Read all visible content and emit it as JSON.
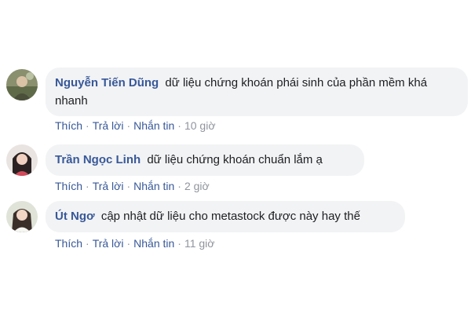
{
  "comments": [
    {
      "author": "Nguyễn Tiến Dũng",
      "text": "dữ liệu chứng khoán phái sinh của phần mềm khá nhanh",
      "actions": {
        "like": "Thích",
        "reply": "Trả lời",
        "message": "Nhắn tin",
        "time": "10 giờ"
      },
      "avatar_icon": "avatar-photo-icon"
    },
    {
      "author": "Trần Ngọc Linh",
      "text": "dữ liệu chứng khoán chuẩn lắm ạ",
      "actions": {
        "like": "Thích",
        "reply": "Trả lời",
        "message": "Nhắn tin",
        "time": "2 giờ"
      },
      "avatar_icon": "avatar-photo-icon"
    },
    {
      "author": "Út Ngơ",
      "text": "cập nhật dữ liệu cho metastock được này hay thế",
      "actions": {
        "like": "Thích",
        "reply": "Trả lời",
        "message": "Nhắn tin",
        "time": "11 giờ"
      },
      "avatar_icon": "avatar-photo-icon"
    }
  ],
  "colors": {
    "bubble_bg": "#f2f3f5",
    "author": "#385898",
    "text": "#1c1e21",
    "meta": "#90949c"
  }
}
